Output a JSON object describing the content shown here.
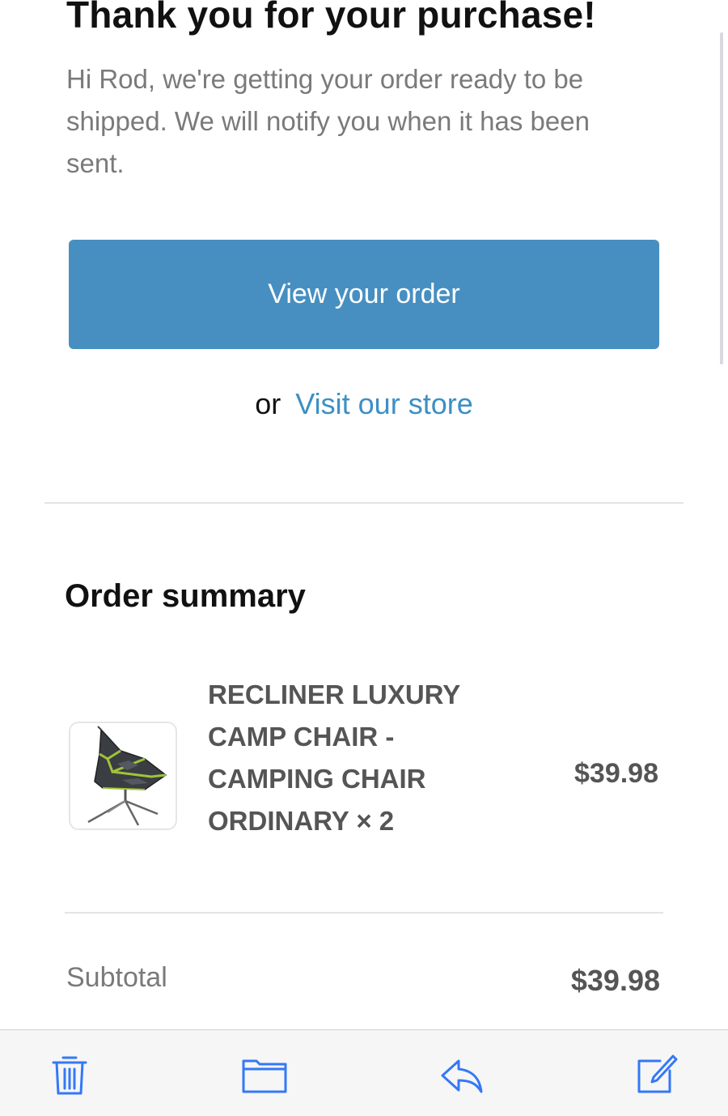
{
  "email": {
    "title": "Thank you for your purchase!",
    "intro": "Hi Rod, we're getting your order ready to be shipped. We will notify you when it has been sent.",
    "view_order_button": "View your order",
    "or_text": "or",
    "visit_store_link": "Visit our store"
  },
  "order_summary": {
    "heading": "Order summary",
    "items": [
      {
        "name": "RECLINER LUXURY CAMP CHAIR - CAMPING CHAIR ORDINARY × 2",
        "price": "$39.98",
        "image": "camp-chair-image"
      }
    ],
    "subtotal_label": "Subtotal",
    "subtotal_value": "$39.98"
  },
  "toolbar": {
    "icons": [
      "trash-icon",
      "folder-icon",
      "reply-icon",
      "compose-icon"
    ],
    "accent_color": "#3478f6"
  },
  "colors": {
    "button": "#478fc1",
    "link": "#3d8fc4"
  }
}
